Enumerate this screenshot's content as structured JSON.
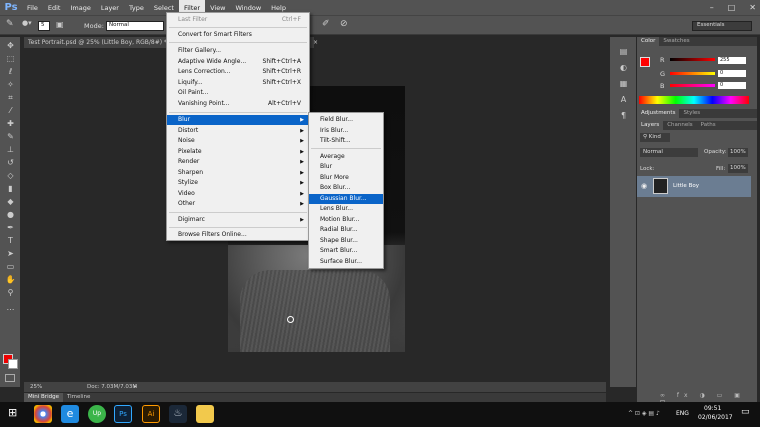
{
  "app": {
    "logo": "Ps",
    "menus": [
      "File",
      "Edit",
      "Image",
      "Layer",
      "Type",
      "Select",
      "Filter",
      "View",
      "Window",
      "Help"
    ],
    "active_menu": "Filter"
  },
  "options": {
    "mode_label": "Mode:",
    "mode_value": "Normal",
    "size_value": "5",
    "workspace": "Essentials"
  },
  "document": {
    "tab_title": "Test Portrait.psd @ 25% (Little Boy, RGB/8#) *",
    "zoom": "25%",
    "doc_info": "Doc: 7.03M/7.03M"
  },
  "bottom_tabs": [
    "Mini Bridge",
    "Timeline"
  ],
  "filter_menu": {
    "last_filter": {
      "label": "Last Filter",
      "shortcut": "Ctrl+F"
    },
    "convert": "Convert for Smart Filters",
    "items1": [
      {
        "label": "Filter Gallery...",
        "shortcut": ""
      },
      {
        "label": "Adaptive Wide Angle...",
        "shortcut": "Shift+Ctrl+A"
      },
      {
        "label": "Lens Correction...",
        "shortcut": "Shift+Ctrl+R"
      },
      {
        "label": "Liquify...",
        "shortcut": "Shift+Ctrl+X"
      },
      {
        "label": "Oil Paint...",
        "shortcut": ""
      },
      {
        "label": "Vanishing Point...",
        "shortcut": "Alt+Ctrl+V"
      }
    ],
    "submenus": [
      "Blur",
      "Distort",
      "Noise",
      "Pixelate",
      "Render",
      "Sharpen",
      "Stylize",
      "Video",
      "Other"
    ],
    "digimarc": "Digimarc",
    "browse": "Browse Filters Online..."
  },
  "blur_menu": {
    "group1": [
      "Field Blur...",
      "Iris Blur...",
      "Tilt-Shift..."
    ],
    "group2": [
      "Average",
      "Blur",
      "Blur More",
      "Box Blur...",
      "Gaussian Blur...",
      "Lens Blur...",
      "Motion Blur...",
      "Radial Blur...",
      "Shape Blur...",
      "Smart Blur...",
      "Surface Blur..."
    ],
    "highlighted": "Gaussian Blur..."
  },
  "color_panel": {
    "tabs": [
      "Color",
      "Swatches"
    ],
    "r_label": "R",
    "g_label": "G",
    "b_label": "B",
    "r": "255",
    "g": "0",
    "b": "0",
    "fg_color": "#ff0000",
    "bg_color": "#ffffff"
  },
  "adjust_panel": {
    "tabs": [
      "Adjustments",
      "Styles"
    ]
  },
  "layers_panel": {
    "tabs": [
      "Layers",
      "Channels",
      "Paths"
    ],
    "kind": "Kind",
    "blend": "Normal",
    "opacity_label": "Opacity:",
    "opacity": "100%",
    "lock_label": "Lock:",
    "fill_label": "Fill:",
    "fill": "100%",
    "layer_name": "Little Boy"
  },
  "taskbar": {
    "lang": "ENG",
    "time": "09:51",
    "date": "02/06/2017"
  }
}
